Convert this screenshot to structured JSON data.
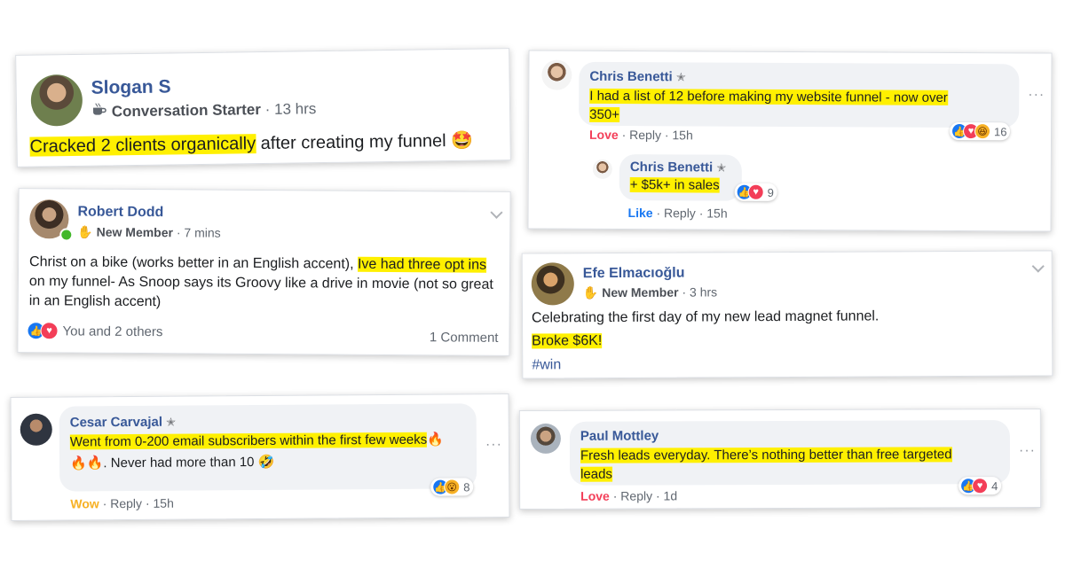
{
  "colors": {
    "highlight": "#fff000",
    "name_blue": "#385898",
    "like_blue": "#1877f2",
    "love_red": "#f33e58",
    "wow_yellow": "#f7b125"
  },
  "post_slogan": {
    "name": "Slogan S",
    "badge_icon": "coffee-cup-icon",
    "badge": "Conversation Starter",
    "time": "13 hrs",
    "text_highlight": "Cracked 2 clients organically",
    "text_rest": " after creating my funnel",
    "emoji": "🤩"
  },
  "post_robert": {
    "name": "Robert Dodd",
    "badge_icon": "waving-hand-icon",
    "badge": "New Member",
    "time": "7 mins",
    "text_1": "Christ on a bike (works better in an English accent), ",
    "text_highlight": "Ive had three opt ins",
    "text_2": " on my funnel- As Snoop says its Groovy like a drive in movie (not so great in an English accent)",
    "reactions_text": "You and 2 others",
    "comments": "1 Comment"
  },
  "comment_cesar": {
    "name": "Cesar Carvajal",
    "text_highlight": "Went from 0-200 email subscribers within the first few weeks",
    "text_emoji_1": "🔥",
    "text_emoji_2": "🔥🔥",
    "text_rest": ". Never had more than 10 ",
    "text_emoji_3": "🤣",
    "reaction_count": "8",
    "action_react": "Wow",
    "action_reply": "Reply",
    "time": "15h"
  },
  "comment_chris": {
    "name": "Chris Benetti",
    "text_highlight_1": "I had a list of 12 before making my website funnel - now over",
    "text_highlight_2": "350+",
    "reaction_count": "16",
    "action_react": "Love",
    "action_reply": "Reply",
    "time": "15h",
    "reply": {
      "name": "Chris Benetti",
      "text_highlight": "+ $5k+ in sales",
      "reaction_count": "9",
      "action_react": "Like",
      "action_reply": "Reply",
      "time": "15h"
    }
  },
  "post_efe": {
    "name": "Efe Elmacıoğlu",
    "badge_icon": "waving-hand-icon",
    "badge": "New Member",
    "time": "3 hrs",
    "text_1": "Celebrating the first day of my new lead magnet funnel.",
    "text_highlight": "Broke $6K!",
    "hashtag": "#win"
  },
  "comment_paul": {
    "name": "Paul Mottley",
    "text_highlight_1": "Fresh leads everyday. There’s nothing better than free targeted",
    "text_highlight_2": "leads",
    "reaction_count": "4",
    "action_react": "Love",
    "action_reply": "Reply",
    "time": "1d"
  },
  "separator": "·",
  "more_icon": "···"
}
